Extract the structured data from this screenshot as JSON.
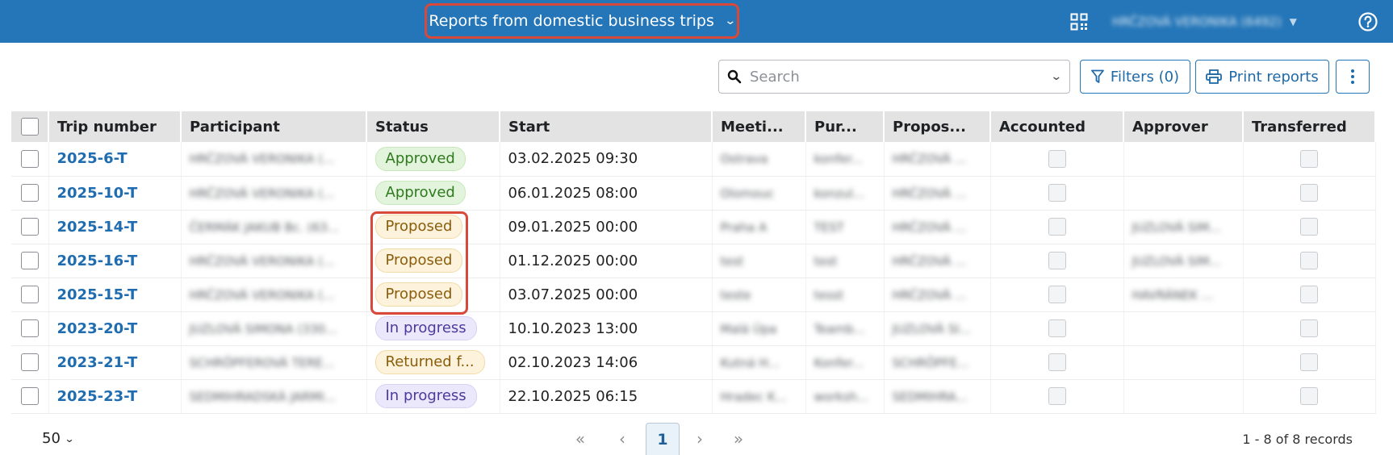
{
  "header": {
    "report_title": "Reports from domestic business trips",
    "user_name": "HRČZOVÁ VERONIKA (6492)"
  },
  "toolbar": {
    "search_placeholder": "Search",
    "filters_label": "Filters (0)",
    "print_label": "Print reports"
  },
  "table": {
    "columns": [
      "Trip number",
      "Participant",
      "Status",
      "Start",
      "Meeti...",
      "Pur...",
      "Propos...",
      "Accounted",
      "Approver",
      "Transferred"
    ],
    "rows": [
      {
        "trip": "2025-6-T",
        "participant": "HRČZOVÁ VERONIKA (...",
        "status": "Approved",
        "status_type": "approved",
        "start": "03.02.2025 09:30",
        "meeting": "Ostrava",
        "purpose": "konfer...",
        "proposer": "HRČZOVÁ ...",
        "approver": ""
      },
      {
        "trip": "2025-10-T",
        "participant": "HRČZOVÁ VERONIKA (...",
        "status": "Approved",
        "status_type": "approved",
        "start": "06.01.2025 08:00",
        "meeting": "Olomouc",
        "purpose": "konzul...",
        "proposer": "HRČZOVÁ ...",
        "approver": ""
      },
      {
        "trip": "2025-14-T",
        "participant": "ČERMÁK JAKUB Bc. (63...",
        "status": "Proposed",
        "status_type": "proposed",
        "start": "09.01.2025 00:00",
        "meeting": "Praha A",
        "purpose": "TEST",
        "proposer": "HRČZOVÁ ...",
        "approver": "JUZLOVÁ SIM..."
      },
      {
        "trip": "2025-16-T",
        "participant": "HRČZOVÁ VERONIKA (...",
        "status": "Proposed",
        "status_type": "proposed",
        "start": "01.12.2025 00:00",
        "meeting": "test",
        "purpose": "test",
        "proposer": "HRČZOVÁ ...",
        "approver": "JUZLOVÁ SIM..."
      },
      {
        "trip": "2025-15-T",
        "participant": "HRČZOVÁ VERONIKA (...",
        "status": "Proposed",
        "status_type": "proposed",
        "start": "03.07.2025 00:00",
        "meeting": "teste",
        "purpose": "tesst",
        "proposer": "HRČZOVÁ ...",
        "approver": "HAVRÁNEK ..."
      },
      {
        "trip": "2023-20-T",
        "participant": "JUZLOVÁ SIMONA (330...",
        "status": "In progress",
        "status_type": "inprogress",
        "start": "10.10.2023 13:00",
        "meeting": "Malá Úpa",
        "purpose": "Teamb...",
        "proposer": "JUZLOVÁ SI...",
        "approver": ""
      },
      {
        "trip": "2023-21-T",
        "participant": "SCHRÖPFEROVÁ TERE...",
        "status": "Returned f...",
        "status_type": "returned",
        "start": "02.10.2023 14:06",
        "meeting": "Kutná H...",
        "purpose": "Konfer...",
        "proposer": "SCHRÖPFE...",
        "approver": ""
      },
      {
        "trip": "2025-23-T",
        "participant": "SEDMIHRADSKÁ JARMI...",
        "status": "In progress",
        "status_type": "inprogress",
        "start": "22.10.2025 06:15",
        "meeting": "Hradec K...",
        "purpose": "worksh...",
        "proposer": "SEDMIHRA...",
        "approver": ""
      }
    ]
  },
  "footer": {
    "page_size": "50",
    "current_page": "1",
    "records_text": "1 - 8 of 8 records"
  },
  "colors": {
    "header_bg": "#2576b8",
    "highlight": "#d9493a",
    "link": "#1f6db0"
  }
}
